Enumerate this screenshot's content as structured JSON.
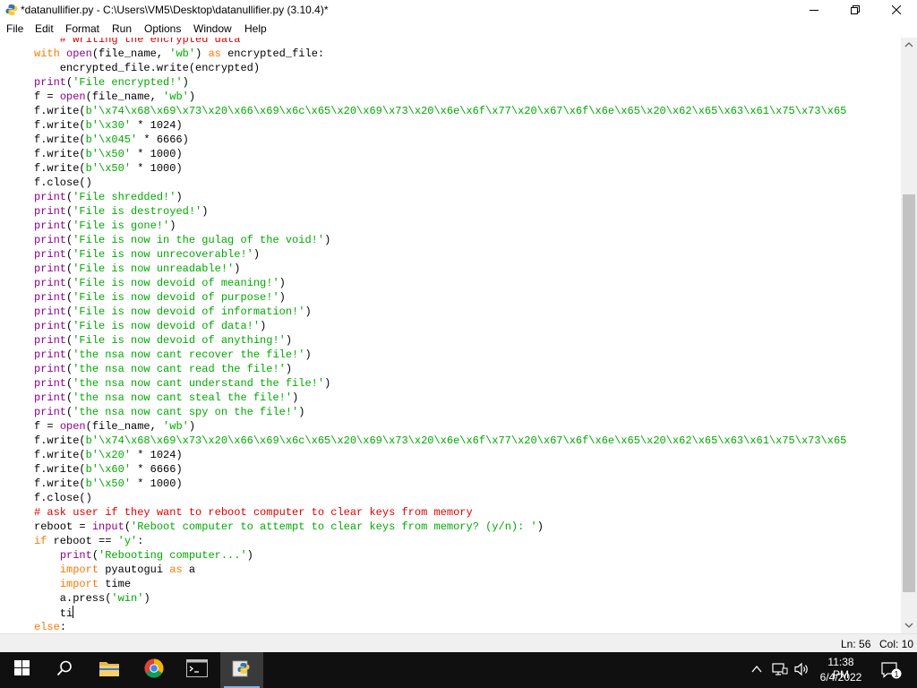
{
  "window": {
    "title": "*datanullifier.py - C:\\Users\\VM5\\Desktop\\datanullifier.py (3.10.4)*",
    "icons": {
      "app": "python-idle-icon",
      "minimize": "minimize-icon",
      "maximize": "maximize-icon",
      "close": "close-icon"
    }
  },
  "menu": [
    "File",
    "Edit",
    "Format",
    "Run",
    "Options",
    "Window",
    "Help"
  ],
  "editor": {
    "lines": [
      [
        {
          "t": "    # writing the encrypted data",
          "c": "cm"
        }
      ],
      [
        {
          "t": "with",
          "c": "kw"
        },
        {
          "t": " "
        },
        {
          "t": "open",
          "c": "bi"
        },
        {
          "t": "(file_name, "
        },
        {
          "t": "'wb'",
          "c": "str"
        },
        {
          "t": ") "
        },
        {
          "t": "as",
          "c": "kw"
        },
        {
          "t": " encrypted_file:"
        }
      ],
      [
        {
          "t": "    encrypted_file.write(encrypted)"
        }
      ],
      [
        {
          "t": "print",
          "c": "bi"
        },
        {
          "t": "("
        },
        {
          "t": "'File encrypted!'",
          "c": "str"
        },
        {
          "t": ")"
        }
      ],
      [
        {
          "t": "f = "
        },
        {
          "t": "open",
          "c": "bi"
        },
        {
          "t": "(file_name, "
        },
        {
          "t": "'wb'",
          "c": "str"
        },
        {
          "t": ")"
        }
      ],
      [
        {
          "t": "f.write("
        },
        {
          "t": "b'\\x74\\x68\\x69\\x73\\x20\\x66\\x69\\x6c\\x65\\x20\\x69\\x73\\x20\\x6e\\x6f\\x77\\x20\\x67\\x6f\\x6e\\x65\\x20\\x62\\x65\\x63\\x61\\x75\\x73\\x65",
          "c": "str"
        }
      ],
      [
        {
          "t": "f.write("
        },
        {
          "t": "b'\\x30'",
          "c": "str"
        },
        {
          "t": " * 1024)"
        }
      ],
      [
        {
          "t": "f.write("
        },
        {
          "t": "b'\\x045'",
          "c": "str"
        },
        {
          "t": " * 6666)"
        }
      ],
      [
        {
          "t": "f.write("
        },
        {
          "t": "b'\\x50'",
          "c": "str"
        },
        {
          "t": " * 1000)"
        }
      ],
      [
        {
          "t": "f.write("
        },
        {
          "t": "b'\\x50'",
          "c": "str"
        },
        {
          "t": " * 1000)"
        }
      ],
      [
        {
          "t": "f.close()"
        }
      ],
      [
        {
          "t": "print",
          "c": "bi"
        },
        {
          "t": "("
        },
        {
          "t": "'File shredded!'",
          "c": "str"
        },
        {
          "t": ")"
        }
      ],
      [
        {
          "t": "print",
          "c": "bi"
        },
        {
          "t": "("
        },
        {
          "t": "'File is destroyed!'",
          "c": "str"
        },
        {
          "t": ")"
        }
      ],
      [
        {
          "t": "print",
          "c": "bi"
        },
        {
          "t": "("
        },
        {
          "t": "'File is gone!'",
          "c": "str"
        },
        {
          "t": ")"
        }
      ],
      [
        {
          "t": "print",
          "c": "bi"
        },
        {
          "t": "("
        },
        {
          "t": "'File is now in the gulag of the void!'",
          "c": "str"
        },
        {
          "t": ")"
        }
      ],
      [
        {
          "t": "print",
          "c": "bi"
        },
        {
          "t": "("
        },
        {
          "t": "'File is now unrecoverable!'",
          "c": "str"
        },
        {
          "t": ")"
        }
      ],
      [
        {
          "t": "print",
          "c": "bi"
        },
        {
          "t": "("
        },
        {
          "t": "'File is now unreadable!'",
          "c": "str"
        },
        {
          "t": ")"
        }
      ],
      [
        {
          "t": "print",
          "c": "bi"
        },
        {
          "t": "("
        },
        {
          "t": "'File is now devoid of meaning!'",
          "c": "str"
        },
        {
          "t": ")"
        }
      ],
      [
        {
          "t": "print",
          "c": "bi"
        },
        {
          "t": "("
        },
        {
          "t": "'File is now devoid of purpose!'",
          "c": "str"
        },
        {
          "t": ")"
        }
      ],
      [
        {
          "t": "print",
          "c": "bi"
        },
        {
          "t": "("
        },
        {
          "t": "'File is now devoid of information!'",
          "c": "str"
        },
        {
          "t": ")"
        }
      ],
      [
        {
          "t": "print",
          "c": "bi"
        },
        {
          "t": "("
        },
        {
          "t": "'File is now devoid of data!'",
          "c": "str"
        },
        {
          "t": ")"
        }
      ],
      [
        {
          "t": "print",
          "c": "bi"
        },
        {
          "t": "("
        },
        {
          "t": "'File is now devoid of anything!'",
          "c": "str"
        },
        {
          "t": ")"
        }
      ],
      [
        {
          "t": "print",
          "c": "bi"
        },
        {
          "t": "("
        },
        {
          "t": "'the nsa now cant recover the file!'",
          "c": "str"
        },
        {
          "t": ")"
        }
      ],
      [
        {
          "t": "print",
          "c": "bi"
        },
        {
          "t": "("
        },
        {
          "t": "'the nsa now cant read the file!'",
          "c": "str"
        },
        {
          "t": ")"
        }
      ],
      [
        {
          "t": "print",
          "c": "bi"
        },
        {
          "t": "("
        },
        {
          "t": "'the nsa now cant understand the file!'",
          "c": "str"
        },
        {
          "t": ")"
        }
      ],
      [
        {
          "t": "print",
          "c": "bi"
        },
        {
          "t": "("
        },
        {
          "t": "'the nsa now cant steal the file!'",
          "c": "str"
        },
        {
          "t": ")"
        }
      ],
      [
        {
          "t": "print",
          "c": "bi"
        },
        {
          "t": "("
        },
        {
          "t": "'the nsa now cant spy on the file!'",
          "c": "str"
        },
        {
          "t": ")"
        }
      ],
      [
        {
          "t": "f = "
        },
        {
          "t": "open",
          "c": "bi"
        },
        {
          "t": "(file_name, "
        },
        {
          "t": "'wb'",
          "c": "str"
        },
        {
          "t": ")"
        }
      ],
      [
        {
          "t": "f.write("
        },
        {
          "t": "b'\\x74\\x68\\x69\\x73\\x20\\x66\\x69\\x6c\\x65\\x20\\x69\\x73\\x20\\x6e\\x6f\\x77\\x20\\x67\\x6f\\x6e\\x65\\x20\\x62\\x65\\x63\\x61\\x75\\x73\\x65",
          "c": "str"
        }
      ],
      [
        {
          "t": "f.write("
        },
        {
          "t": "b'\\x20'",
          "c": "str"
        },
        {
          "t": " * 1024)"
        }
      ],
      [
        {
          "t": "f.write("
        },
        {
          "t": "b'\\x60'",
          "c": "str"
        },
        {
          "t": " * 6666)"
        }
      ],
      [
        {
          "t": "f.write("
        },
        {
          "t": "b'\\x50'",
          "c": "str"
        },
        {
          "t": " * 1000)"
        }
      ],
      [
        {
          "t": "f.close()"
        }
      ],
      [
        {
          "t": "# ask user if they want to reboot computer to clear keys from memory",
          "c": "cm"
        }
      ],
      [
        {
          "t": "reboot = "
        },
        {
          "t": "input",
          "c": "bi"
        },
        {
          "t": "("
        },
        {
          "t": "'Reboot computer to attempt to clear keys from memory? (y/n): '",
          "c": "str"
        },
        {
          "t": ")"
        }
      ],
      [
        {
          "t": "if",
          "c": "kw"
        },
        {
          "t": " reboot == "
        },
        {
          "t": "'y'",
          "c": "str"
        },
        {
          "t": ":"
        }
      ],
      [
        {
          "t": "    "
        },
        {
          "t": "print",
          "c": "bi"
        },
        {
          "t": "("
        },
        {
          "t": "'Rebooting computer...'",
          "c": "str"
        },
        {
          "t": ")"
        }
      ],
      [
        {
          "t": "    "
        },
        {
          "t": "import",
          "c": "kw"
        },
        {
          "t": " pyautogui "
        },
        {
          "t": "as",
          "c": "kw"
        },
        {
          "t": " a"
        }
      ],
      [
        {
          "t": "    "
        },
        {
          "t": "import",
          "c": "kw"
        },
        {
          "t": " time"
        }
      ],
      [
        {
          "t": "    a.press("
        },
        {
          "t": "'win'",
          "c": "str"
        },
        {
          "t": ")"
        }
      ],
      [
        {
          "t": "    ti"
        },
        {
          "cursor": true
        }
      ],
      [
        {
          "t": "else",
          "c": "kw"
        },
        {
          "t": ":"
        }
      ]
    ]
  },
  "status": {
    "line": "Ln: 56",
    "col": "Col: 10"
  },
  "taskbar": {
    "apps": [
      {
        "name": "start-button",
        "icon": "windows-logo-icon"
      },
      {
        "name": "search-button",
        "icon": "search-icon"
      },
      {
        "name": "file-explorer-button",
        "icon": "folder-icon"
      },
      {
        "name": "chrome-button",
        "icon": "chrome-icon"
      },
      {
        "name": "command-prompt-button",
        "icon": "terminal-icon"
      },
      {
        "name": "python-idle-button",
        "icon": "python-icon"
      }
    ],
    "clock": {
      "time": "11:38 PM",
      "date": "6/4/2022"
    },
    "notification_count": "1"
  },
  "colors": {
    "keyword": "#ff7700",
    "builtin": "#900090",
    "string": "#00aa00",
    "comment": "#dd0000",
    "taskbar": "#101010",
    "active_app_indicator": "#76b9ed"
  }
}
